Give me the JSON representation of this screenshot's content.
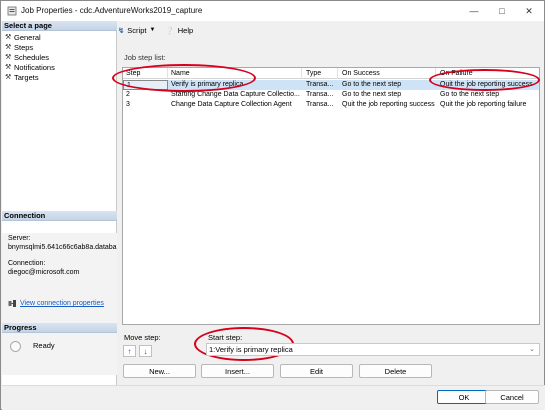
{
  "window": {
    "title": "Job Properties - cdc.AdventureWorks2019_capture"
  },
  "left_pane": {
    "select_page_header": "Select a page",
    "pages": [
      "General",
      "Steps",
      "Schedules",
      "Notifications",
      "Targets"
    ],
    "connection_header": "Connection",
    "server_label": "Server:",
    "server_value": "bnymsqlmi5.641c66c6ab8a.databa",
    "connection_label": "Connection:",
    "connection_value": "diegoc@microsoft.com",
    "view_connection_link": "View connection properties",
    "progress_header": "Progress",
    "progress_status": "Ready"
  },
  "toolbar": {
    "script_label": "Script",
    "help_label": "Help"
  },
  "job_step_list": {
    "label": "Job step list:",
    "columns": [
      "Step",
      "Name",
      "Type",
      "On Success",
      "On Failure"
    ],
    "rows": [
      {
        "step": "1",
        "name": "Verify is primary replica",
        "type": "Transa...",
        "on_success": "Go to the next step",
        "on_failure": "Quit the job reporting success",
        "selected": true
      },
      {
        "step": "2",
        "name": "Starting Change Data Capture Collectio...",
        "type": "Transa...",
        "on_success": "Go to the next step",
        "on_failure": "Go to the next step",
        "selected": false
      },
      {
        "step": "3",
        "name": "Change Data Capture Collection Agent",
        "type": "Transa...",
        "on_success": "Quit the job reporting success",
        "on_failure": "Quit the job reporting failure",
        "selected": false
      }
    ]
  },
  "move_step_label": "Move step:",
  "start_step": {
    "label": "Start step:",
    "value": "1:Verify is primary replica"
  },
  "buttons": {
    "new": "New...",
    "insert": "Insert...",
    "edit": "Edit",
    "delete": "Delete",
    "ok": "OK",
    "cancel": "Cancel"
  },
  "annotation_color": "#d6001c"
}
